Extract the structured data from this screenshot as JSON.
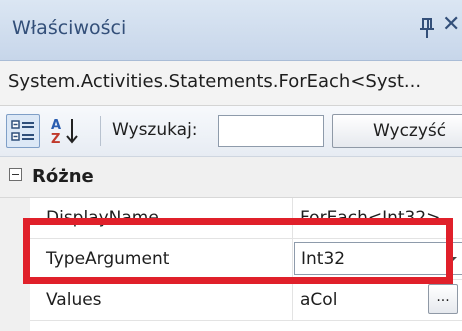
{
  "window": {
    "title": "Właściwości",
    "close_glyph": "✕"
  },
  "object_name": "System.Activities.Statements.ForEach<Syst...",
  "toolbar": {
    "categorized_icon": "categorized-view-icon",
    "alphabetical_icon": "alphabetical-sort-icon",
    "search_label": "Wyszukaj:",
    "search_value": "",
    "clear_label": "Wyczyść"
  },
  "category": {
    "label": "Różne"
  },
  "properties": [
    {
      "name": "DisplayName",
      "value": "ForEach<Int32>"
    },
    {
      "name": "TypeArgument",
      "value": "Int32"
    },
    {
      "name": "Values",
      "value": "aCol"
    }
  ],
  "ellipsis_label": "...",
  "colors": {
    "highlight": "#e0202a",
    "titlebar": "#c7d6ea",
    "title_text": "#334f79"
  }
}
